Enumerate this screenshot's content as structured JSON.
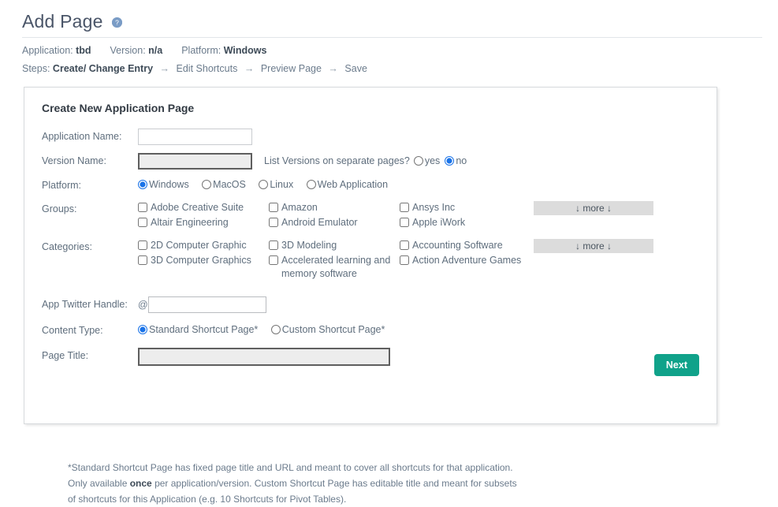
{
  "header": {
    "title": "Add Page",
    "help_icon": "help-circle-icon",
    "meta": {
      "application_label": "Application:",
      "application_value": "tbd",
      "version_label": "Version:",
      "version_value": "n/a",
      "platform_label": "Platform:",
      "platform_value": "Windows"
    },
    "steps": {
      "label": "Steps:",
      "arrow": "→",
      "items": [
        {
          "label": "Create/ Change Entry",
          "current": true
        },
        {
          "label": "Edit Shortcuts",
          "current": false
        },
        {
          "label": "Preview Page",
          "current": false
        },
        {
          "label": "Save",
          "current": false
        }
      ]
    }
  },
  "panel": {
    "title": "Create New Application Page",
    "fields": {
      "application_name": {
        "label": "Application Name:",
        "value": "",
        "placeholder": ""
      },
      "version_name": {
        "label": "Version Name:",
        "value": "",
        "placeholder": ""
      },
      "version_question": {
        "text": "List Versions on separate pages?",
        "options": [
          {
            "label": "yes",
            "selected": false
          },
          {
            "label": "no",
            "selected": true
          }
        ]
      },
      "platform": {
        "label": "Platform:",
        "options": [
          {
            "label": "Windows",
            "selected": true
          },
          {
            "label": "MacOS",
            "selected": false
          },
          {
            "label": "Linux",
            "selected": false
          },
          {
            "label": "Web Application",
            "selected": false
          }
        ]
      },
      "groups": {
        "label": "Groups:",
        "more_label": "↓ more ↓",
        "columns": [
          [
            {
              "label": "Adobe Creative Suite",
              "checked": false
            },
            {
              "label": "Altair Engineering",
              "checked": false
            }
          ],
          [
            {
              "label": "Amazon",
              "checked": false
            },
            {
              "label": "Android Emulator",
              "checked": false
            }
          ],
          [
            {
              "label": "Ansys Inc",
              "checked": false
            },
            {
              "label": "Apple iWork",
              "checked": false
            }
          ]
        ]
      },
      "categories": {
        "label": "Categories:",
        "more_label": "↓ more ↓",
        "columns": [
          [
            {
              "label": "2D Computer Graphic",
              "checked": false
            },
            {
              "label": "3D Computer Graphics",
              "checked": false
            }
          ],
          [
            {
              "label": "3D Modeling",
              "checked": false
            },
            {
              "label": "Accelerated learning and memory software",
              "checked": false
            }
          ],
          [
            {
              "label": "Accounting Software",
              "checked": false
            },
            {
              "label": "Action Adventure Games",
              "checked": false
            }
          ]
        ]
      },
      "twitter_handle": {
        "label": "App Twitter Handle:",
        "prefix": "@",
        "value": "",
        "placeholder": ""
      },
      "content_type": {
        "label": "Content Type:",
        "options": [
          {
            "label": "Standard Shortcut Page*",
            "selected": true
          },
          {
            "label": "Custom Shortcut Page*",
            "selected": false
          }
        ]
      },
      "page_title": {
        "label": "Page Title:",
        "value": "",
        "placeholder": ""
      }
    },
    "next_button": "Next",
    "footnote": {
      "part1": "*Standard Shortcut Page has fixed page title and URL and meant to cover all shortcuts for that application. Only available ",
      "emphasis": "once",
      "part2": " per application/version. Custom Shortcut Page has editable title and meant for subsets of shortcuts for this Application (e.g. 10 Shortcuts for Pivot Tables)."
    }
  },
  "colors": {
    "accent_teal": "#10a28a",
    "radio_blue": "#1a73e8",
    "more_button_gray": "#dcdcdc",
    "text_muted": "#5f6e7d"
  }
}
